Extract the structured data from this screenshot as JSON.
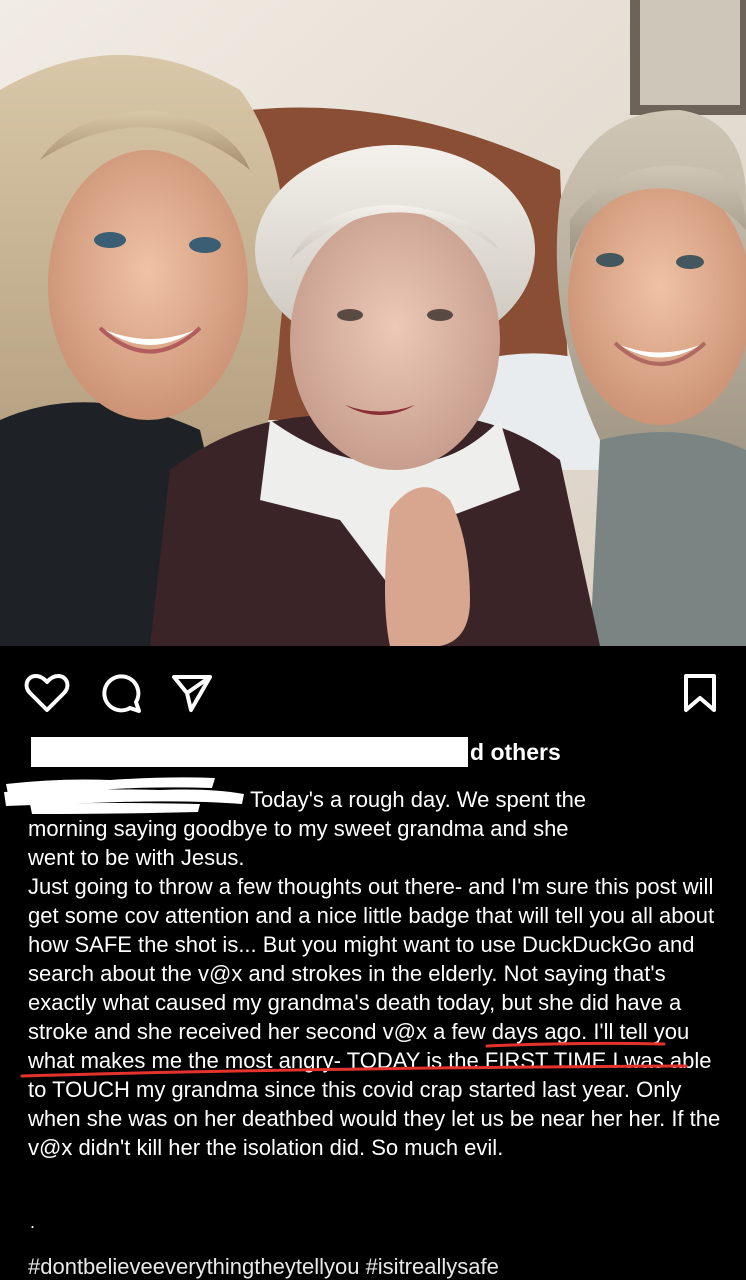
{
  "post": {
    "photo_alt": "",
    "likes_suffix": "d others",
    "caption_line1": "Today's a rough day. We spent the",
    "caption_line2": "morning saying goodbye to my sweet grandma and she",
    "caption_line3": "went to be with Jesus.",
    "body_part1": "Just going to throw a few thoughts out there- and I'm sure this post will get some cov attention and a nice little badge that will tell you all about how SAFE the shot is... But you might want to use DuckDuckGo and search about the v@x and strokes in the elderly. Not saying that's exactly what caused my grandma's death today, but ",
    "body_highlight": "she did have a stroke and she received her second v@x a few days ago.",
    "body_part2": " I'll tell you what makes me the most angry- TODAY is the FIRST TIME I was able to TOUCH my grandma since this covid crap started last year. Only when she was on her deathbed would they let us be near her her. If the v@x didn't kill her the isolation did. So much evil.",
    "dot": ".",
    "hashtags": "#dontbelieveeverythingtheytellyou #isitreallysafe"
  },
  "icons": {
    "like": "heart-icon",
    "comment": "comment-bubble-icon",
    "share": "paper-plane-icon",
    "save": "bookmark-icon"
  },
  "colors": {
    "background": "#000000",
    "text": "#ffffff",
    "annotation_underline": "#e5322d",
    "redaction": "#ffffff"
  }
}
